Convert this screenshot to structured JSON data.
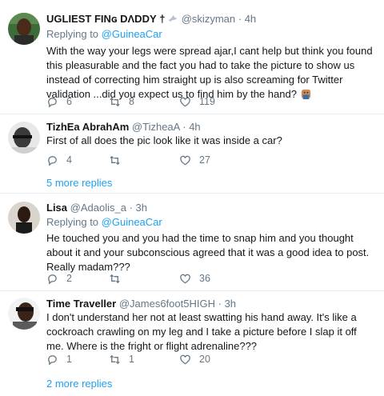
{
  "tweets": [
    {
      "name": "UGLIEST FINɢ DΛDDY",
      "name_suffix": "†",
      "handle": "@skizyman",
      "separator": "·",
      "time": "4h",
      "replying_prefix": "Replying to",
      "replying_to": "@GuineaCar",
      "text": "With the way your legs were spread ajar,I cant help but think you found this pleasurable and the fact you had to take the picture to show us instead of correcting him straight up is also screaming for Twitter validation ...did you expect us to find him by the hand?",
      "replies": "6",
      "retweets": "8",
      "likes": "119"
    },
    {
      "name": "TizhEa AbrahAm",
      "handle": "@TizheaA",
      "separator": "·",
      "time": "4h",
      "text": "First of all does the pic look like it was inside a car?",
      "replies": "4",
      "retweets": "",
      "likes": "27",
      "more_replies": "5 more replies"
    },
    {
      "name": "Lisa",
      "handle": "@Adaolis_a",
      "separator": "·",
      "time": "3h",
      "replying_prefix": "Replying to",
      "replying_to": "@GuineaCar",
      "text": "He touched you and you had the time to snap him and you thought about it and your subconscious agreed that it was a good idea to post. Really madam???",
      "replies": "2",
      "retweets": "",
      "likes": "36"
    },
    {
      "name": "Time Traveller",
      "handle": "@James6foot5HIGH",
      "separator": "·",
      "time": "3h",
      "text": "I don't understand her not at least swatting his hand away. It's like a cockroach crawling on my leg and I take a picture before I slap it off me. Where is the fright or flight adrenaline???",
      "replies": "1",
      "retweets": "1",
      "likes": "20",
      "more_replies": "2 more replies"
    }
  ],
  "colors": {
    "text": "#14171a",
    "muted": "#657786",
    "link": "#1da1f2",
    "divider": "#e6ecf0"
  },
  "icons": {
    "reply": "reply-icon",
    "retweet": "retweet-icon",
    "like": "heart-icon",
    "dove": "dove-icon",
    "emoji": "blushing-face-icon"
  }
}
